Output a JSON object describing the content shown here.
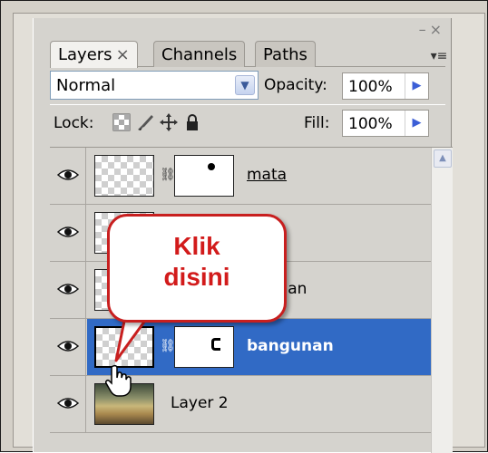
{
  "tabs": {
    "layers_label": "Layers",
    "channels_label": "Channels",
    "paths_label": "Paths",
    "close_glyph": "×"
  },
  "window_controls": {
    "minimize": "–",
    "close": "×"
  },
  "blend_mode": {
    "value": "Normal"
  },
  "opacity": {
    "label": "Opacity:",
    "value": "100%"
  },
  "lock": {
    "label": "Lock:"
  },
  "fill": {
    "label": "Fill:",
    "value": "100%"
  },
  "layers": [
    {
      "name": "mata",
      "visible": true,
      "selected": false
    },
    {
      "name": "",
      "visible": true,
      "selected": false
    },
    {
      "name": "bayangan",
      "visible": true,
      "selected": false
    },
    {
      "name": "bangunan",
      "visible": true,
      "selected": true
    },
    {
      "name": "Layer 2",
      "visible": true,
      "selected": false
    }
  ],
  "callout": {
    "line1": "Klik",
    "line2": "disini"
  },
  "colors": {
    "selection": "#316ac5",
    "callout_border": "#c81f1f",
    "callout_text": "#d21b1b",
    "arrow_blue": "#3b5ed6"
  },
  "icons": {
    "visibility": "eye-icon",
    "lock_transparent": "lock-transparent-pixels-icon",
    "lock_image": "lock-image-pixels-icon",
    "lock_position": "lock-position-icon",
    "lock_all": "lock-all-icon",
    "link": "chain-link-icon",
    "panel_menu": "panel-menu-icon",
    "cursor": "hand-cursor-icon"
  }
}
